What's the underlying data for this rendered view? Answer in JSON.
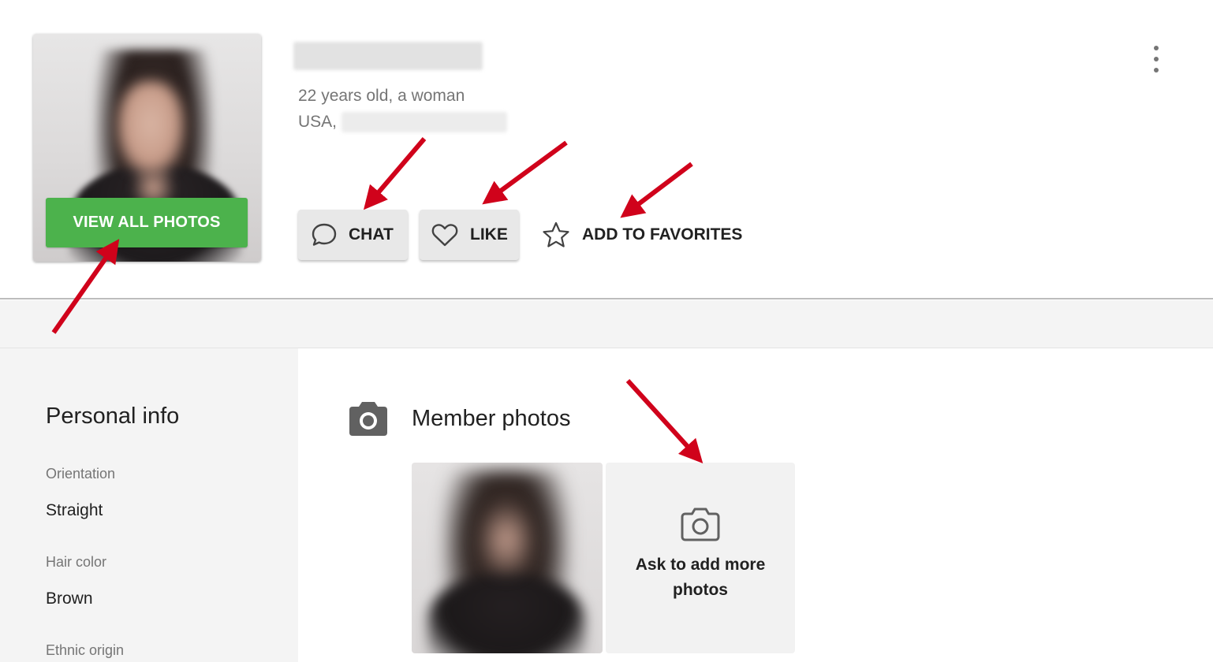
{
  "profile": {
    "age_gender": "22 years old, a woman",
    "location_prefix": "USA,"
  },
  "buttons": {
    "view_all_photos": "VIEW ALL PHOTOS",
    "chat": "CHAT",
    "like": "LIKE",
    "add_to_favorites": "ADD TO FAVORITES"
  },
  "personal_info": {
    "title": "Personal info",
    "fields": [
      {
        "label": "Orientation",
        "value": "Straight"
      },
      {
        "label": "Hair color",
        "value": "Brown"
      },
      {
        "label": "Ethnic origin",
        "value": ""
      }
    ]
  },
  "member_photos": {
    "title": "Member photos",
    "ask_more": "Ask to add more photos"
  },
  "colors": {
    "accent_green": "#4cb24c",
    "annotation_red": "#d0021b",
    "panel_gray": "#f4f4f4"
  },
  "icons": [
    "more-vert-icon",
    "chat-bubble-icon",
    "heart-icon",
    "star-icon",
    "camera-icon"
  ]
}
